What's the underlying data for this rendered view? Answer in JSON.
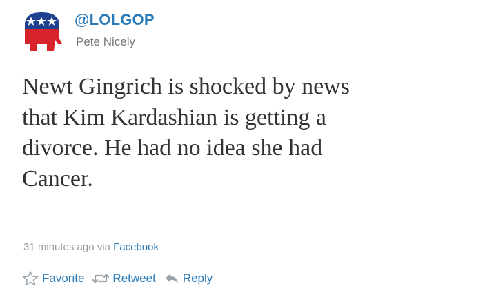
{
  "author": {
    "handle": "@LOLGOP",
    "name": "Pete Nicely",
    "avatar_icon": "republican-elephant-logo"
  },
  "tweet": {
    "lines": [
      "Newt Gingrich is shocked by news",
      "that Kim Kardashian is getting a",
      "divorce. He had no idea she had",
      "Cancer."
    ]
  },
  "meta": {
    "time": "31 minutes ago",
    "via": "via",
    "source": "Facebook"
  },
  "actions": {
    "favorite": "Favorite",
    "retweet": "Retweet",
    "reply": "Reply"
  },
  "colors": {
    "link": "#2b7bb9",
    "text": "#333333",
    "muted": "#999999",
    "elephant_red": "#d8232a",
    "elephant_blue": "#1f3f8f"
  }
}
